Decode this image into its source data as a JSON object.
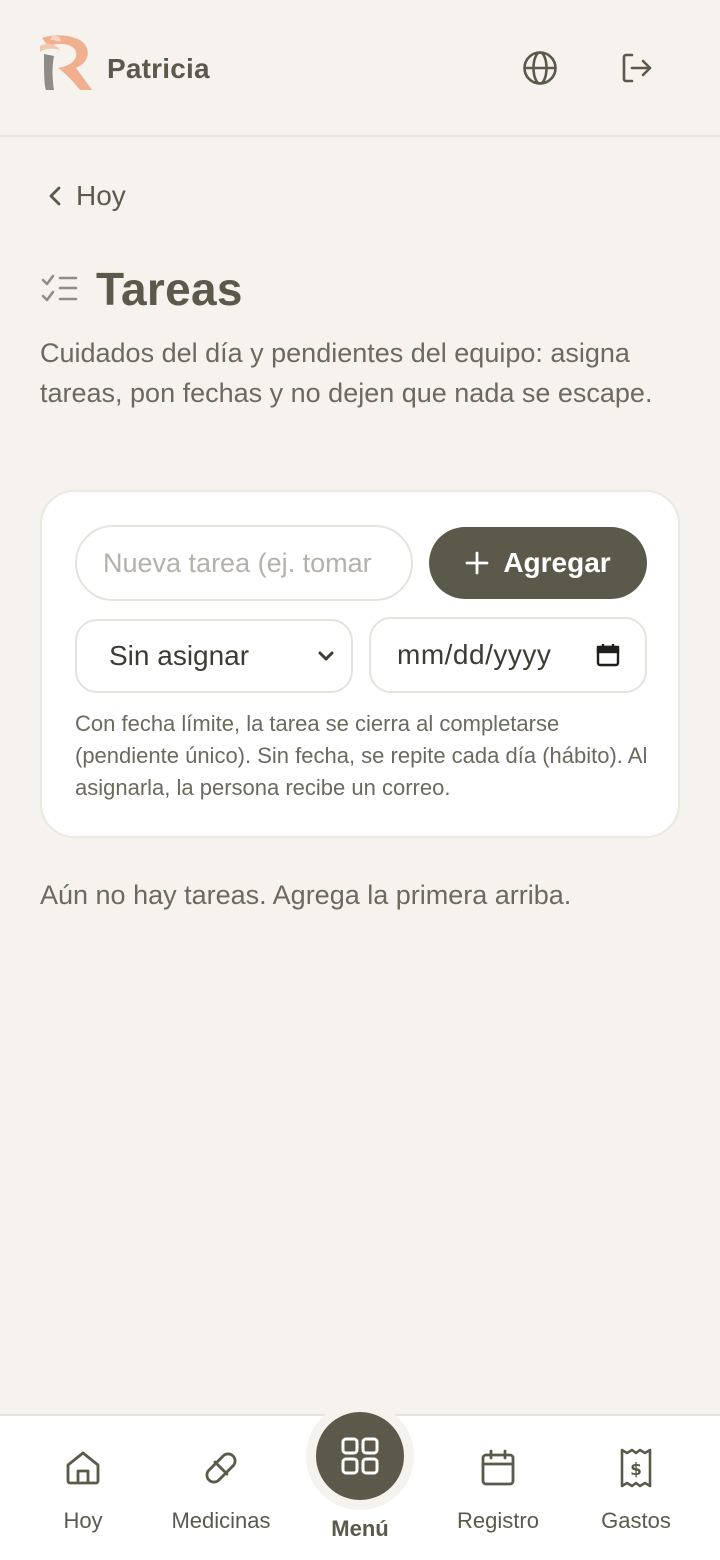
{
  "header": {
    "user_name": "Patricia",
    "icons": [
      "app-logo",
      "globe-icon",
      "logout-icon"
    ]
  },
  "back": {
    "label": "Hoy"
  },
  "page": {
    "title": "Tareas",
    "subtitle": "Cuidados del día y pendientes del equipo: asigna tareas, pon fechas y no dejen que nada se escape."
  },
  "form": {
    "task_placeholder": "Nueva tarea (ej. tomar",
    "add_label": "Agregar",
    "assign_value": "Sin asignar",
    "date_value": "mm/dd/yyyy",
    "hint": "Con fecha límite, la tarea se cierra al completarse (pendiente único). Sin fecha, se repite cada día (hábito). Al asignarla, la persona recibe un correo."
  },
  "empty_state": "Aún no hay tareas. Agrega la primera arriba.",
  "bottom_nav": {
    "items": [
      {
        "label": "Hoy",
        "icon": "home-icon"
      },
      {
        "label": "Medicinas",
        "icon": "pill-icon"
      },
      {
        "label": "Menú",
        "icon": "grid-icon",
        "active": true
      },
      {
        "label": "Registro",
        "icon": "calendar-icon"
      },
      {
        "label": "Gastos",
        "icon": "receipt-icon"
      }
    ]
  },
  "colors": {
    "background": "#f6f3ee",
    "primary": "#5b5a4a",
    "card": "#ffffff",
    "logo_peach": "#f0b08f",
    "logo_gray": "#8e8c86"
  }
}
